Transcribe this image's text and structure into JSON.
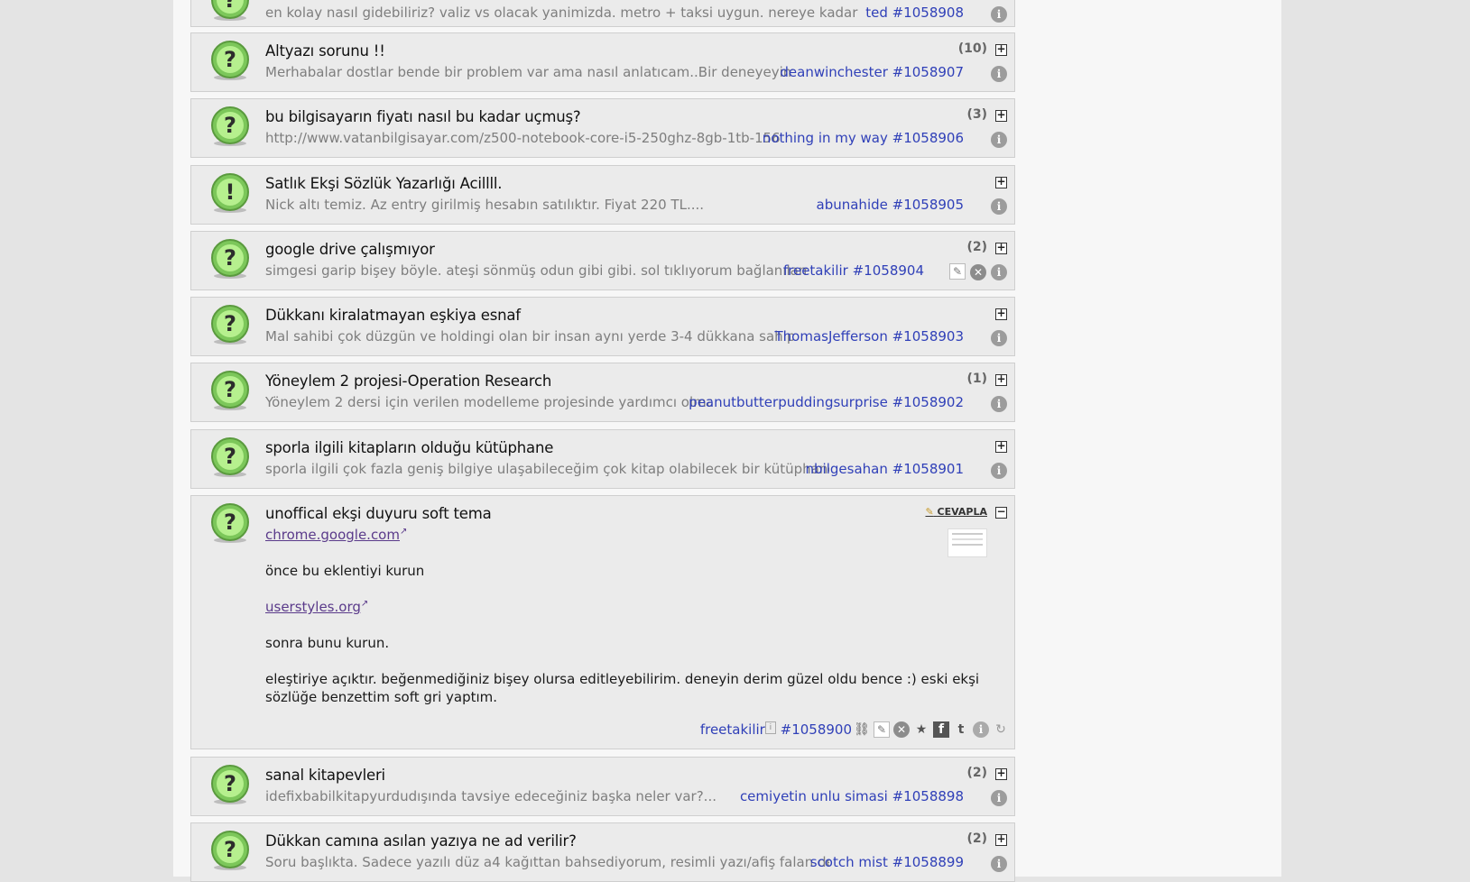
{
  "entries": [
    {
      "snippet": "en kolay nasıl gidebiliriz? valiz vs olacak yanimizda. metro + taksi uygun. nereye kadar metroyla",
      "meta": "ted #1058908"
    },
    {
      "title": "Altyazı sorunu !!",
      "snippet": "Merhabalar dostlar bende bir problem var ama nasıl anlatıcam..Bir deneyeyim..Şir",
      "meta": "deanwinchester #1058907",
      "count": "(10)"
    },
    {
      "title": "bu bilgisayarın fiyatı nasıl bu kadar uçmuş?",
      "snippet": "http://www.vatanbilgisayar.com/z500-notebook-core-i5-250ghz-8gb-1tb-156",
      "meta": "nothing in my way #1058906",
      "count": "(3)"
    },
    {
      "title": "Satlık Ekşi Sözlük Yazarlığı Acillll.",
      "snippet": "Nick altı temiz. Az entry girilmiş hesabın satılıktır. Fiyat 220 TL....",
      "meta": "abunahide #1058905",
      "count": ""
    },
    {
      "title": "google drive çalışmıyor",
      "snippet": "simgesi garip bişey böyle. ateşi sönmüş odun gibi gibi. sol tıklıyorum bağlanılamac",
      "meta": "freetakilir #1058904",
      "count": "(2)"
    },
    {
      "title": "Dükkanı kiralatmayan eşkiya esnaf",
      "snippet": "Mal sahibi çok düzgün ve holdingi olan bir insan aynı yerde 3-4 dükkana sahip. E",
      "meta": "ThomasJefferson #1058903",
      "count": ""
    },
    {
      "title": "Yöneylem 2 projesi-Operation Research",
      "snippet": "Yöneylem 2 dersi için verilen modelleme projesinde yardımcı olmak",
      "meta": "peanutbutterpuddingsurprise #1058902",
      "count": "(1)"
    },
    {
      "title": "sporla ilgili kitapların olduğu kütüphane",
      "snippet": "sporla ilgili çok fazla geniş bilgiye ulaşabileceğim çok kitap olabilecek bir kütüphane a",
      "meta": "nbilgesahan #1058901",
      "count": ""
    }
  ],
  "expanded": {
    "title": "unoffical ekşi duyuru soft tema",
    "reply_label": "CEVAPLA",
    "link1": "chrome.google.com",
    "line1": "önce bu eklentiyi kurun",
    "link2": "userstyles.org",
    "line2": "sonra bunu kurun.",
    "para_a": "eleştiriye açıktır. beğenmediğiniz bişey olursa editleyebilirim. deneyin derim güzel oldu bence :) eski ekşi",
    "para_b": "sözlüğe benzettim soft gri yaptım.",
    "author": "freetakilir",
    "entry_id": "#1058900"
  },
  "entries_after": [
    {
      "title": "sanal kitapevleri",
      "snippet": "idefixbabilkitapyurdudışında tavsiye edeceğiniz başka neler var?...",
      "meta": "cemiyetin unlu simasi #1058898",
      "count": "(2)"
    },
    {
      "title": "Dükkan camına asılan yazıya ne ad verilir?",
      "snippet": "Soru başlıkta. Sadece yazılı düz a4 kağıttan bahsediyorum, resimli yazı/afiş falan değil",
      "meta": "scotch mist #1058899",
      "count": "(2)"
    }
  ],
  "colors": {
    "link": "#3040b8",
    "question_icon": "#8fd36a",
    "exclaim_icon": "#8fd36a"
  },
  "icons": {
    "question": "question-mark-icon",
    "exclaim": "exclamation-icon"
  }
}
